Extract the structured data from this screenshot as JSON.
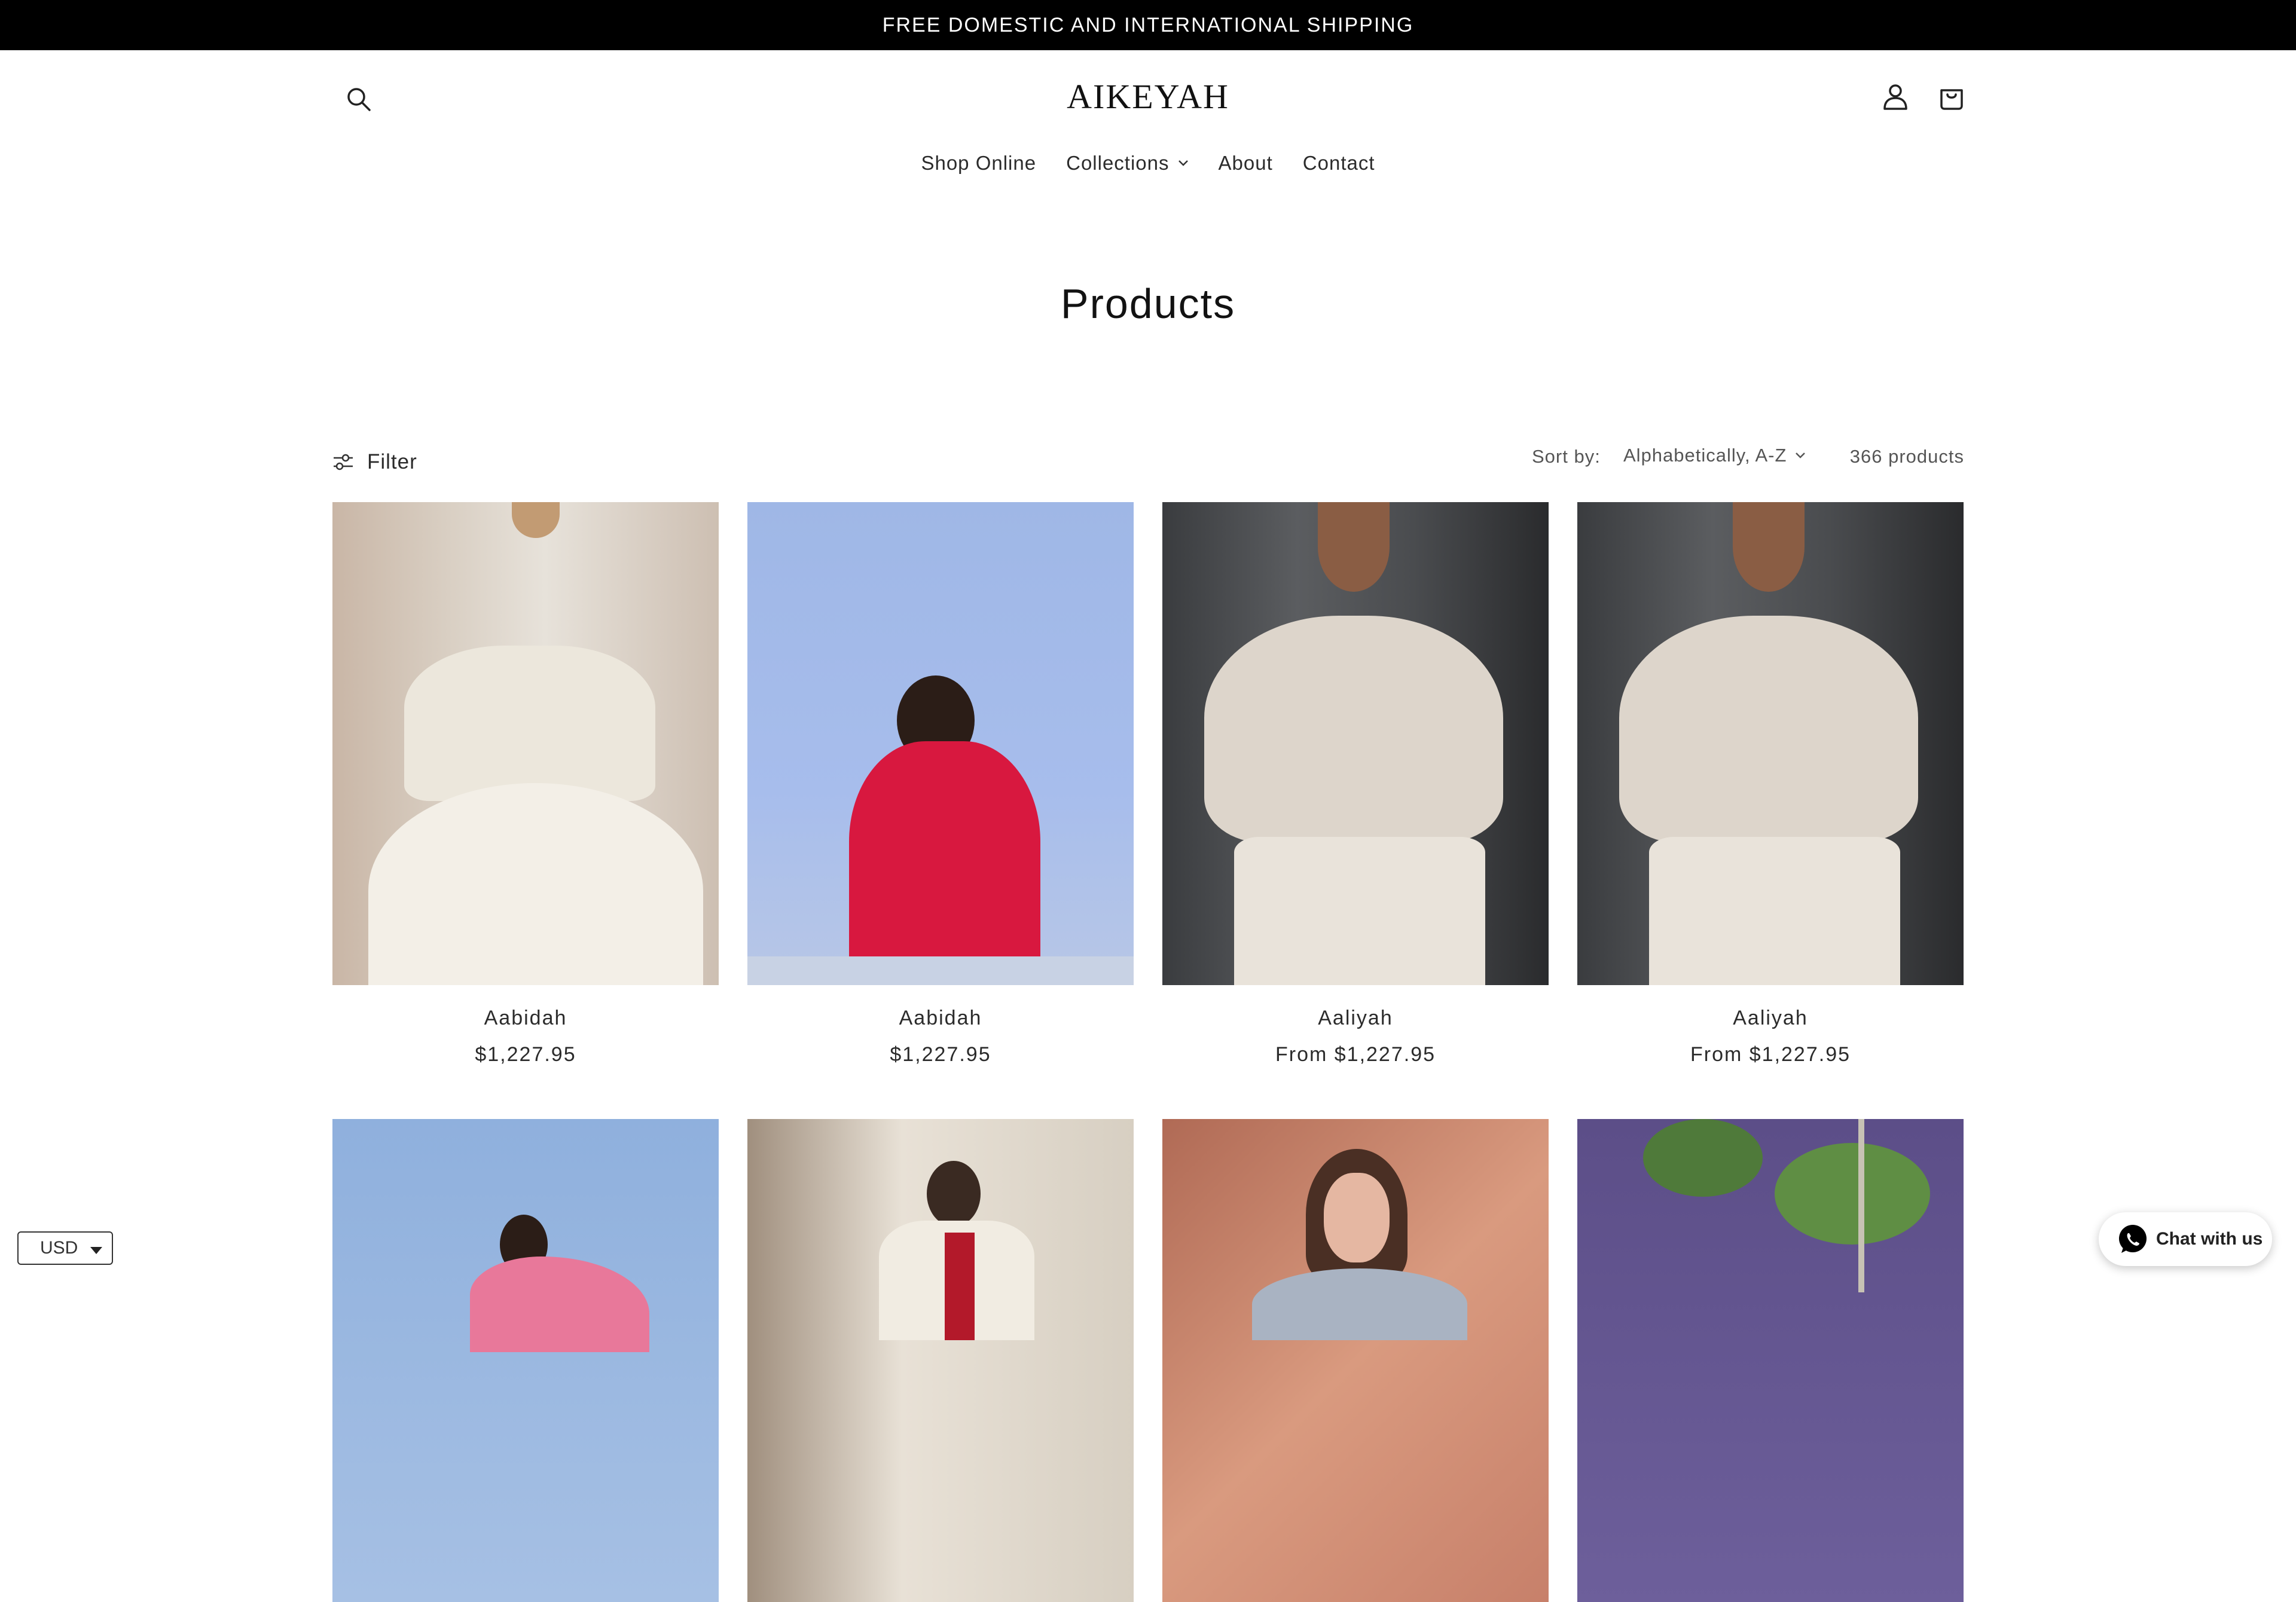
{
  "announcement": {
    "text": "FREE DOMESTIC AND INTERNATIONAL SHIPPING"
  },
  "header": {
    "logo": "AIKEYAH",
    "icons": {
      "search": "search-icon",
      "account": "account-icon",
      "cart": "cart-icon"
    }
  },
  "nav": {
    "items": [
      {
        "label": "Shop Online"
      },
      {
        "label": "Collections",
        "has_dropdown": true
      },
      {
        "label": "About"
      },
      {
        "label": "Contact"
      }
    ]
  },
  "page": {
    "title": "Products"
  },
  "toolbar": {
    "filter_label": "Filter",
    "sort_label": "Sort by:",
    "sort_value": "Alphabetically, A-Z",
    "product_count": "366 products"
  },
  "products": [
    {
      "name": "Aabidah",
      "price": "$1,227.95"
    },
    {
      "name": "Aabidah",
      "price": "$1,227.95"
    },
    {
      "name": "Aaliyah",
      "price": "From $1,227.95"
    },
    {
      "name": "Aaliyah",
      "price": "From $1,227.95"
    }
  ],
  "currency": {
    "value": "USD"
  },
  "chat": {
    "label": "Chat with us"
  },
  "colors": {
    "announcement_bg": "#000000",
    "text": "#121212",
    "whatsapp": "#000000"
  }
}
